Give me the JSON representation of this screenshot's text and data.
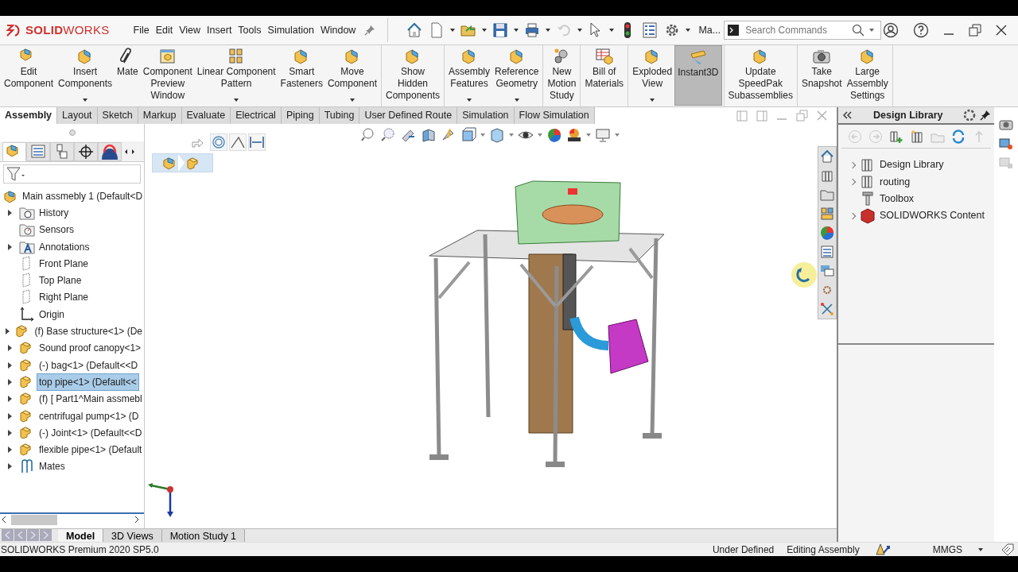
{
  "app": {
    "logo": "**SOLID**WORKS"
  },
  "menu": [
    "File",
    "Edit",
    "View",
    "Insert",
    "Tools",
    "Simulation",
    "Window"
  ],
  "quick_access": [
    {
      "dropdown": false,
      "disabled": false
    },
    {
      "dropdown": true,
      "disabled": false
    },
    {
      "dropdown": true,
      "disabled": false
    },
    {
      "dropdown": true,
      "disabled": false
    },
    {
      "dropdown": true,
      "disabled": false
    },
    {
      "dropdown": true,
      "disabled": true
    },
    {
      "dropdown": true,
      "disabled": false
    },
    {
      "dropdown": false,
      "disabled": false
    },
    {
      "dropdown": false,
      "disabled": false
    },
    {
      "dropdown": true,
      "disabled": false
    }
  ],
  "user_label": "Ma...",
  "search": {
    "placeholder": "Search Commands"
  },
  "ribbon_groups": [
    [
      {
        "label": "Edit\nComponent",
        "dropdown": false,
        "selected": false
      },
      {
        "label": "Insert\nComponents",
        "dropdown": true,
        "selected": false
      },
      {
        "label": "Mate",
        "dropdown": false,
        "selected": false
      },
      {
        "label": "Component\nPreview\nWindow",
        "dropdown": false,
        "selected": false
      },
      {
        "label": "Linear Component\nPattern",
        "dropdown": true,
        "selected": false
      },
      {
        "label": "Smart\nFasteners",
        "dropdown": false,
        "selected": false
      },
      {
        "label": "Move\nComponent",
        "dropdown": true,
        "selected": false
      }
    ],
    [
      {
        "label": "Show\nHidden\nComponents",
        "dropdown": false,
        "selected": false
      }
    ],
    [
      {
        "label": "Assembly\nFeatures",
        "dropdown": true,
        "selected": false
      },
      {
        "label": "Reference\nGeometry",
        "dropdown": true,
        "selected": false
      }
    ],
    [
      {
        "label": "New\nMotion\nStudy",
        "dropdown": false,
        "selected": false
      }
    ],
    [
      {
        "label": "Bill of\nMaterials",
        "dropdown": false,
        "selected": false
      }
    ],
    [
      {
        "label": "Exploded\nView",
        "dropdown": true,
        "selected": false
      },
      {
        "label": "Instant3D",
        "dropdown": false,
        "selected": true
      }
    ],
    [
      {
        "label": "Update\nSpeedPak\nSubassemblies",
        "dropdown": false,
        "selected": false
      }
    ],
    [
      {
        "label": "Take\nSnapshot",
        "dropdown": false,
        "selected": false
      },
      {
        "label": "Large\nAssembly\nSettings",
        "dropdown": false,
        "selected": false
      }
    ]
  ],
  "command_tabs": [
    {
      "label": "Assembly",
      "selected": true
    },
    {
      "label": "Layout",
      "selected": false
    },
    {
      "label": "Sketch",
      "selected": false
    },
    {
      "label": "Markup",
      "selected": false
    },
    {
      "label": "Evaluate",
      "selected": false
    },
    {
      "label": "Electrical",
      "selected": false
    },
    {
      "label": "Piping",
      "selected": false
    },
    {
      "label": "Tubing",
      "selected": false
    },
    {
      "label": "User Defined Route",
      "selected": false
    },
    {
      "label": "Simulation",
      "selected": false
    },
    {
      "label": "Flow Simulation",
      "selected": false
    }
  ],
  "feature_panel_tabs": [
    {
      "selected": true
    },
    {
      "selected": false
    },
    {
      "selected": false
    },
    {
      "selected": false
    },
    {
      "selected": false
    }
  ],
  "feature_tree": {
    "root": "Main assmebly 1  (Default<D",
    "items": [
      {
        "label": "History",
        "kind": "folder",
        "expandable": true,
        "selected": false
      },
      {
        "label": "Sensors",
        "kind": "folder",
        "expandable": false,
        "selected": false
      },
      {
        "label": "Annotations",
        "kind": "folder",
        "expandable": true,
        "selected": false
      },
      {
        "label": "Front Plane",
        "kind": "plane",
        "expandable": false,
        "selected": false
      },
      {
        "label": "Top Plane",
        "kind": "plane",
        "expandable": false,
        "selected": false
      },
      {
        "label": "Right Plane",
        "kind": "plane",
        "expandable": false,
        "selected": false
      },
      {
        "label": "Origin",
        "kind": "origin",
        "expandable": false,
        "selected": false
      },
      {
        "label": "(f) Base structure<1> (De",
        "kind": "part",
        "expandable": true,
        "selected": false
      },
      {
        "label": "Sound proof canopy<1>",
        "kind": "part",
        "expandable": true,
        "selected": false
      },
      {
        "label": "(-) bag<1> (Default<<D",
        "kind": "part",
        "expandable": true,
        "selected": false
      },
      {
        "label": "top pipe<1> (Default<<",
        "kind": "part",
        "expandable": true,
        "selected": true
      },
      {
        "label": "(f) [ Part1^Main assmebl",
        "kind": "part",
        "expandable": true,
        "selected": false
      },
      {
        "label": "centrifugal pump<1> (D",
        "kind": "part",
        "expandable": true,
        "selected": false
      },
      {
        "label": "(-) Joint<1> (Default<<D",
        "kind": "part",
        "expandable": true,
        "selected": false
      },
      {
        "label": "flexible pipe<1> (Default",
        "kind": "part",
        "expandable": true,
        "selected": false
      },
      {
        "label": "Mates",
        "kind": "mates",
        "expandable": true,
        "selected": false
      }
    ]
  },
  "design_library": {
    "title": "Design Library",
    "items": [
      {
        "label": "Design Library",
        "kind": "library",
        "expandable": true
      },
      {
        "label": "routing",
        "kind": "library",
        "expandable": true
      },
      {
        "label": "Toolbox",
        "kind": "tool",
        "expandable": false
      },
      {
        "label": "SOLIDWORKS Content",
        "kind": "content",
        "expandable": true
      }
    ]
  },
  "bottom_tabs": [
    {
      "label": "Model",
      "selected": true
    },
    {
      "label": "3D Views",
      "selected": false
    },
    {
      "label": "Motion Study 1",
      "selected": false
    }
  ],
  "status_bar": {
    "product": "SOLIDWORKS Premium 2020 SP5.0",
    "state": "Under Defined",
    "mode": "Editing Assembly",
    "units": "MMGS"
  }
}
